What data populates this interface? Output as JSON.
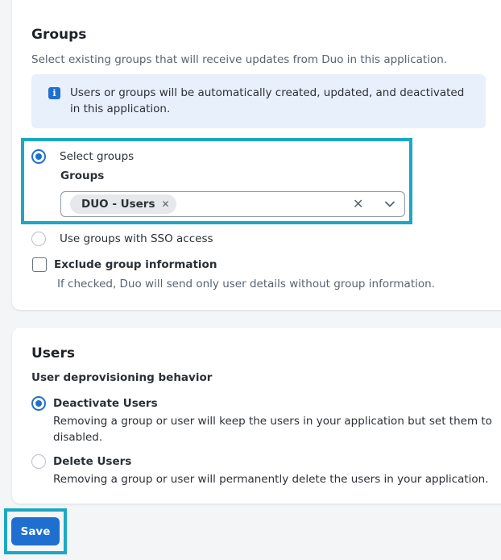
{
  "groups": {
    "title": "Groups",
    "description": "Select existing groups that will receive updates from Duo in this application.",
    "info": "Users or groups will be automatically created, updated, and deactivated in this application.",
    "option_select": "Select groups",
    "field_label": "Groups",
    "selected_chips": [
      "DUO - Users"
    ],
    "option_sso": "Use groups with SSO access",
    "exclude_label": "Exclude group information",
    "exclude_help": "If checked, Duo will send only user details without group information."
  },
  "users": {
    "title": "Users",
    "behavior_label": "User deprovisioning behavior",
    "deactivate_label": "Deactivate Users",
    "deactivate_desc": "Removing a group or user will keep the users in your application but set them to disabled.",
    "delete_label": "Delete Users",
    "delete_desc": "Removing a group or user will permanently delete the users in your application."
  },
  "save_label": "Save",
  "colors": {
    "accent": "#1f6fd1",
    "highlight": "#1aa8c4",
    "info_bg": "#e8f0fc"
  },
  "icons": {
    "info": "info-icon",
    "chip_remove": "close-icon",
    "clear": "close-icon",
    "dropdown": "chevron-down-icon"
  }
}
